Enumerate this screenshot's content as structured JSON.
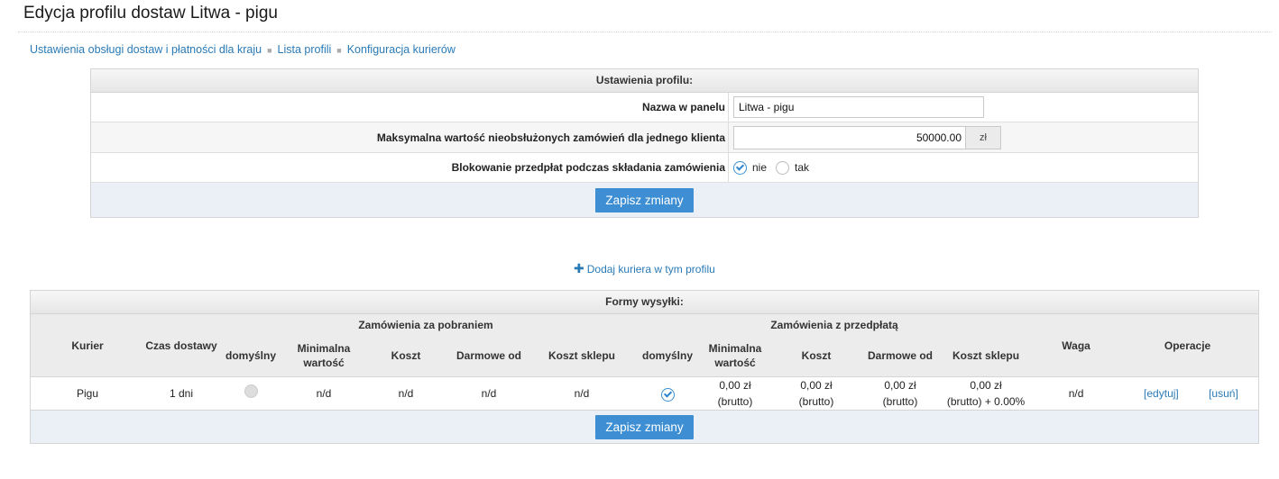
{
  "page": {
    "title": "Edycja profilu dostaw Litwa - pigu"
  },
  "breadcrumb": {
    "items": [
      "Ustawienia obsługi dostaw i płatności dla kraju",
      "Lista profili",
      "Konfiguracja kurierów"
    ]
  },
  "profile": {
    "header": "Ustawienia profilu:",
    "name_label": "Nazwa w panelu",
    "name_value": "Litwa - pigu",
    "max_label": "Maksymalna wartość nieobsłużonych zamówień dla jednego klienta",
    "max_value": "50000.00",
    "max_unit": "zł",
    "block_label": "Blokowanie przedpłat podczas składania zamówienia",
    "opt_no": "nie",
    "opt_yes": "tak",
    "selected": "nie",
    "save": "Zapisz zmiany"
  },
  "add_courier": "Dodaj kuriera w tym profilu",
  "shipping": {
    "header": "Formy wysyłki:",
    "col_courier": "Kurier",
    "col_time": "Czas dostawy",
    "group_cod": "Zamówienia za pobraniem",
    "group_prepaid": "Zamówienia z przedpłatą",
    "col_weight": "Waga",
    "col_ops": "Operacje",
    "sub": {
      "default": "domyślny",
      "min_line1": "Minimalna",
      "min_line2": "wartość",
      "cost": "Koszt",
      "free_from": "Darmowe od",
      "shop_cost": "Koszt sklepu"
    },
    "row": {
      "courier": "Pigu",
      "time": "1 dni",
      "cod_default": false,
      "cod_min": "n/d",
      "cod_cost": "n/d",
      "cod_free": "n/d",
      "cod_shop": "n/d",
      "pre_default": true,
      "pre_min_line1": "0,00 zł",
      "pre_min_line2": "(brutto)",
      "pre_cost_line1": "0,00 zł",
      "pre_cost_line2": "(brutto)",
      "pre_free_line1": "0,00 zł",
      "pre_free_line2": "(brutto)",
      "pre_shop_line1": "0,00 zł",
      "pre_shop_line2": "(brutto) + 0.00%",
      "weight": "n/d",
      "edit": "[edytuj]",
      "delete": "[usuń]"
    },
    "save": "Zapisz zmiany"
  },
  "colors": {
    "link": "#2a7ab6",
    "button": "#3d8ed2",
    "footer_bg": "#eaf0f5"
  }
}
